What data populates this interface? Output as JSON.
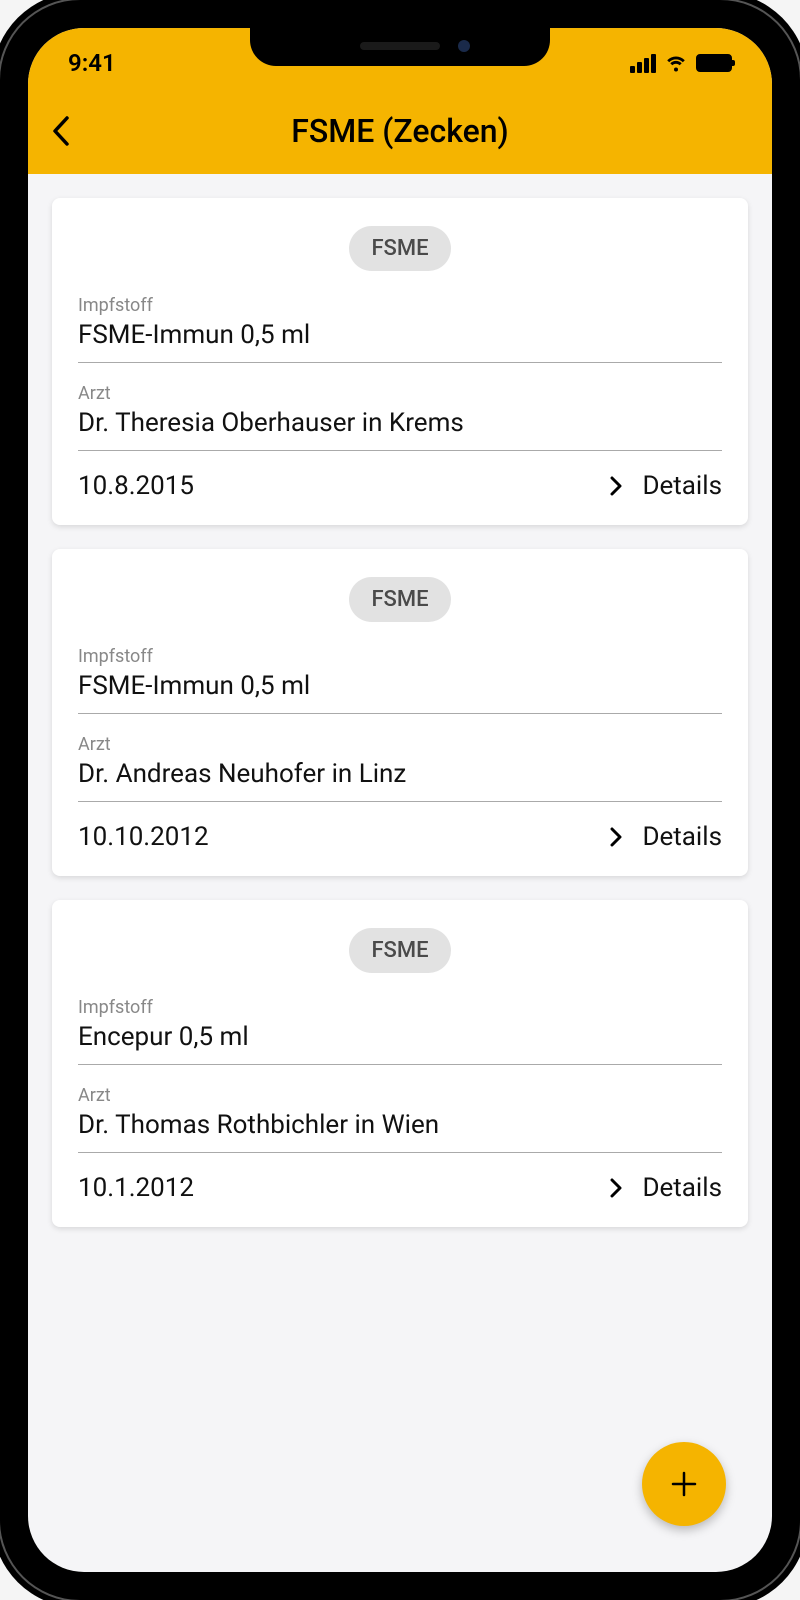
{
  "statusBar": {
    "time": "9:41"
  },
  "header": {
    "title": "FSME (Zecken)"
  },
  "labels": {
    "vaccine": "Impfstoff",
    "doctor": "Arzt",
    "details": "Details"
  },
  "cards": [
    {
      "chip": "FSME",
      "vaccine": "FSME-Immun 0,5 ml",
      "doctor": "Dr. Theresia Oberhauser in Krems",
      "date": "10.8.2015"
    },
    {
      "chip": "FSME",
      "vaccine": "FSME-Immun 0,5 ml",
      "doctor": "Dr. Andreas Neuhofer in Linz",
      "date": "10.10.2012"
    },
    {
      "chip": "FSME",
      "vaccine": "Encepur 0,5 ml",
      "doctor": "Dr. Thomas Rothbichler in Wien",
      "date": "10.1.2012"
    }
  ]
}
